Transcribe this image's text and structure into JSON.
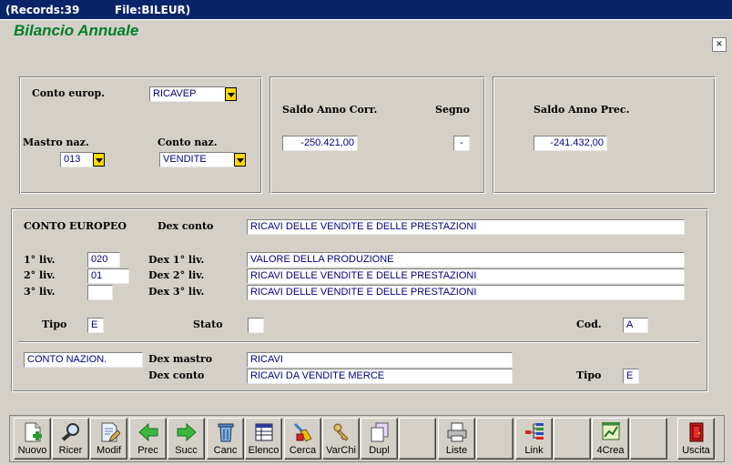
{
  "titlebar": {
    "records": "(Records:39",
    "file": "File:BILEUR)"
  },
  "app_title": "Bilancio Annuale",
  "close_glyph": "×",
  "top": {
    "conto_europ_label": "Conto europ.",
    "conto_europ_value": "RICAVEP",
    "mastro_naz_label": "Mastro naz.",
    "mastro_naz_value": "013",
    "conto_naz_label": "Conto naz.",
    "conto_naz_value": "VENDITE",
    "saldo_corr_label": "Saldo Anno Corr.",
    "saldo_corr_value": "-250.421,00",
    "segno_label": "Segno",
    "segno_value": "-",
    "saldo_prec_label": "Saldo Anno Prec.",
    "saldo_prec_value": "-241.432,00"
  },
  "detail": {
    "conto_europeo_label": "CONTO EUROPEO",
    "dex_conto_label": "Dex conto",
    "dex_conto_value": "RICAVI DELLE VENDITE E DELLE PRESTAZIONI",
    "liv1_label": "1° liv.",
    "liv1_value": "020",
    "liv2_label": "2° liv.",
    "liv2_value": "01",
    "liv3_label": "3° liv.",
    "liv3_value": "",
    "dex1_label": "Dex 1° liv.",
    "dex1_value": "VALORE DELLA PRODUZIONE",
    "dex2_label": "Dex 2° liv.",
    "dex2_value": "RICAVI DELLE VENDITE E DELLE PRESTAZIONI",
    "dex3_label": "Dex 3° liv.",
    "dex3_value": "RICAVI DELLE VENDITE E DELLE PRESTAZIONI",
    "tipo_label": "Tipo",
    "tipo_value": "E",
    "stato_label": "Stato",
    "stato_value": "",
    "cod_label": "Cod.",
    "cod_value": "A",
    "conto_nazion_value": "CONTO NAZION.",
    "dex_mastro_label": "Dex mastro",
    "dex_mastro_value": "RICAVI",
    "dex_conto2_label": "Dex conto",
    "dex_conto2_value": "RICAVI DA VENDITE MERCE",
    "tipo2_label": "Tipo",
    "tipo2_value": "E"
  },
  "toolbar": {
    "nuovo": "Nuovo",
    "ricer": "Ricer",
    "modif": "Modif",
    "prec": "Prec",
    "succ": "Succ",
    "canc": "Canc",
    "elenco": "Elenco",
    "cerca": "Cerca",
    "varchi": "VarChi",
    "dupl": "Dupl",
    "liste": "Liste",
    "link": "Link",
    "crea4": "4Crea",
    "uscita": "Uscita"
  },
  "colors": {
    "titlebar": "#0a246a",
    "app_title": "#007f2a",
    "field_text": "#000080",
    "combo_button": "#ffd800",
    "window": "#d4d0c8"
  }
}
